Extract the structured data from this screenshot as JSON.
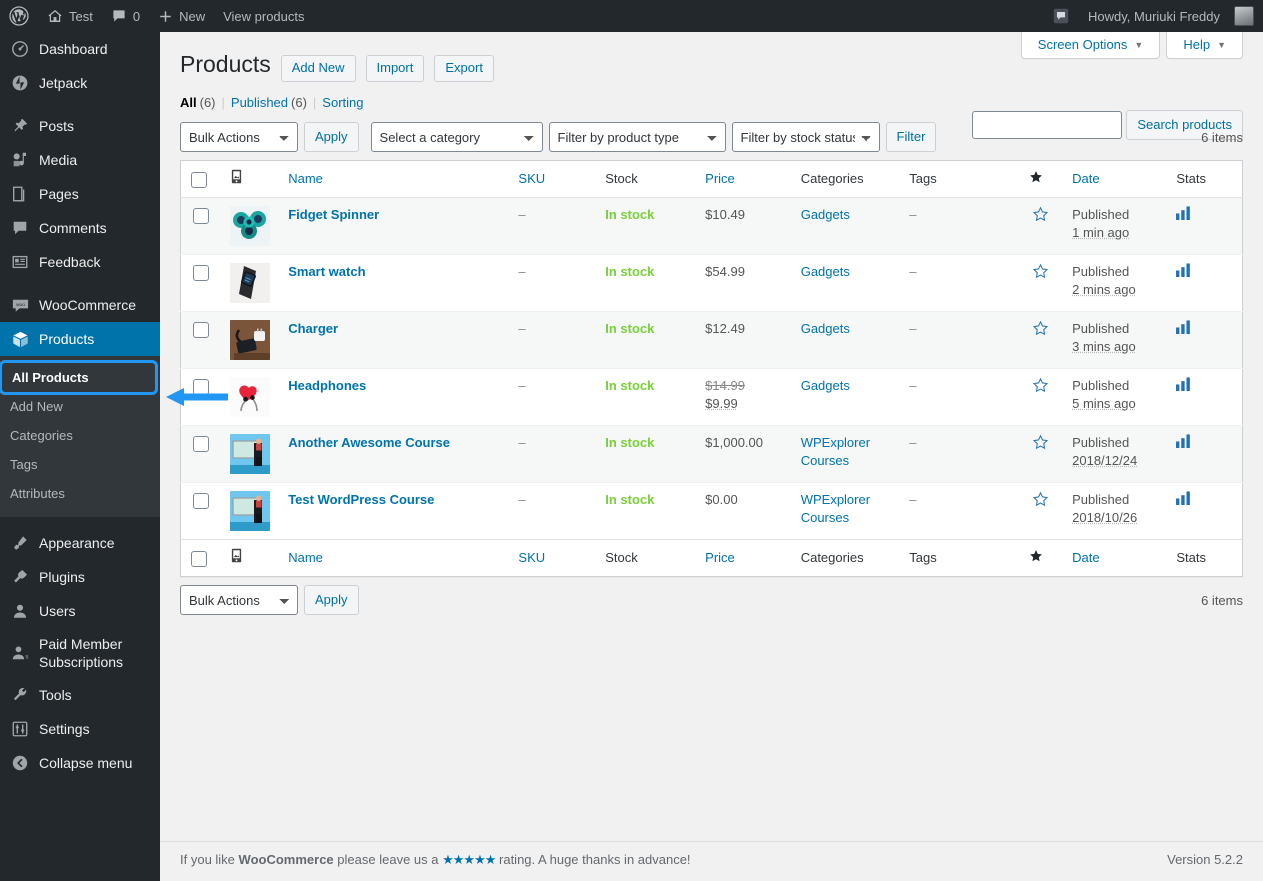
{
  "adminbar": {
    "logo_icon": "wordpress-logo-icon",
    "site_name": "Test",
    "site_icon": "home-icon",
    "comments_icon": "comment-bubble-icon",
    "comments_count": "0",
    "new_icon": "plus-icon",
    "new_label": "New",
    "view_products_label": "View products",
    "notifications_icon": "comment-bubble-icon",
    "howdy": "Howdy, Muriuki Freddy",
    "avatar_icon": "user-avatar"
  },
  "sidebar": {
    "items": [
      {
        "label": "Dashboard",
        "icon": "dashboard-icon",
        "key": "dashboard"
      },
      {
        "label": "Jetpack",
        "icon": "jetpack-icon",
        "key": "jetpack"
      },
      {
        "label": "Posts",
        "icon": "pin-icon",
        "key": "posts"
      },
      {
        "label": "Media",
        "icon": "media-icon",
        "key": "media"
      },
      {
        "label": "Pages",
        "icon": "pages-icon",
        "key": "pages"
      },
      {
        "label": "Comments",
        "icon": "comment-bubble-icon",
        "key": "comments"
      },
      {
        "label": "Feedback",
        "icon": "feedback-icon",
        "key": "feedback"
      },
      {
        "label": "WooCommerce",
        "icon": "woocommerce-icon",
        "key": "woocommerce"
      },
      {
        "label": "Products",
        "icon": "products-box-icon",
        "key": "products",
        "current": true
      },
      {
        "label": "Appearance",
        "icon": "paintbrush-icon",
        "key": "appearance"
      },
      {
        "label": "Plugins",
        "icon": "plug-icon",
        "key": "plugins"
      },
      {
        "label": "Users",
        "icon": "user-icon",
        "key": "users"
      },
      {
        "label": "Paid Member Subscriptions",
        "icon": "members-icon",
        "key": "paid-member-subscriptions"
      },
      {
        "label": "Tools",
        "icon": "wrench-icon",
        "key": "tools"
      },
      {
        "label": "Settings",
        "icon": "sliders-icon",
        "key": "settings"
      },
      {
        "label": "Collapse menu",
        "icon": "collapse-arrow-icon",
        "key": "collapse-menu"
      }
    ],
    "submenu": [
      {
        "label": "All Products",
        "current": true,
        "highlighted": true
      },
      {
        "label": "Add New"
      },
      {
        "label": "Categories"
      },
      {
        "label": "Tags"
      },
      {
        "label": "Attributes"
      }
    ],
    "annotation": {
      "arrow_icon": "left-arrow-annotation",
      "arrow_color": "#2196f3",
      "highlight_color": "#2196f3"
    }
  },
  "screen_meta": {
    "screen_options_label": "Screen Options",
    "help_label": "Help",
    "caret_icon": "chevron-down-icon"
  },
  "header": {
    "title": "Products",
    "actions": [
      {
        "label": "Add New",
        "key": "add-new"
      },
      {
        "label": "Import",
        "key": "import"
      },
      {
        "label": "Export",
        "key": "export"
      }
    ]
  },
  "views": {
    "all_label": "All",
    "all_count": "(6)",
    "published_label": "Published",
    "published_count": "(6)",
    "sorting_label": "Sorting",
    "divider": "|"
  },
  "search": {
    "value": "",
    "placeholder": "",
    "button_label": "Search products"
  },
  "tablenav_top": {
    "bulk_actions": "Bulk Actions",
    "apply_label": "Apply",
    "category_filter": "Select a category",
    "product_type_filter": "Filter by product type",
    "stock_status_filter": "Filter by stock status",
    "filter_label": "Filter",
    "items_count": "6 items"
  },
  "tablenav_bottom": {
    "bulk_actions": "Bulk Actions",
    "apply_label": "Apply",
    "items_count": "6 items"
  },
  "table": {
    "columns": {
      "checkbox": "select-all-checkbox",
      "thumbnail_icon": "image-icon",
      "name": "Name",
      "sku": "SKU",
      "stock": "Stock",
      "price": "Price",
      "categories": "Categories",
      "tags": "Tags",
      "featured_icon": "star-filled-icon",
      "date": "Date",
      "stats": "Stats"
    },
    "rows": [
      {
        "name": "Fidget Spinner",
        "thumb": "fidget-spinner-photo",
        "sku": "–",
        "stock": "In stock",
        "price": "$10.49",
        "sale_price": null,
        "categories": "Gadgets",
        "tags": "–",
        "featured": false,
        "date_status": "Published",
        "date_value": "1 min ago",
        "stats_icon": "bar-chart-icon"
      },
      {
        "name": "Smart watch",
        "thumb": "smart-watch-photo",
        "sku": "–",
        "stock": "In stock",
        "price": "$54.99",
        "sale_price": null,
        "categories": "Gadgets",
        "tags": "–",
        "featured": false,
        "date_status": "Published",
        "date_value": "2 mins ago",
        "stats_icon": "bar-chart-icon"
      },
      {
        "name": "Charger",
        "thumb": "charger-photo",
        "sku": "–",
        "stock": "In stock",
        "price": "$12.49",
        "sale_price": null,
        "categories": "Gadgets",
        "tags": "–",
        "featured": false,
        "date_status": "Published",
        "date_value": "3 mins ago",
        "stats_icon": "bar-chart-icon"
      },
      {
        "name": "Headphones",
        "thumb": "headphones-heart-photo",
        "sku": "–",
        "stock": "In stock",
        "price": "$14.99",
        "sale_price": "$9.99",
        "categories": "Gadgets",
        "tags": "–",
        "featured": false,
        "date_status": "Published",
        "date_value": "5 mins ago",
        "stats_icon": "bar-chart-icon"
      },
      {
        "name": "Another Awesome Course",
        "thumb": "course-presenter-photo",
        "sku": "–",
        "stock": "In stock",
        "price": "$1,000.00",
        "sale_price": null,
        "categories": "WPExplorer Courses",
        "tags": "–",
        "featured": false,
        "date_status": "Published",
        "date_value": "2018/12/24",
        "stats_icon": "bar-chart-icon"
      },
      {
        "name": "Test WordPress Course",
        "thumb": "course-presenter-photo",
        "sku": "–",
        "stock": "In stock",
        "price": "$0.00",
        "sale_price": null,
        "categories": "WPExplorer Courses",
        "tags": "–",
        "featured": false,
        "date_status": "Published",
        "date_value": "2018/10/26",
        "stats_icon": "bar-chart-icon"
      }
    ]
  },
  "footer": {
    "text_before": "If you like",
    "brand": "WooCommerce",
    "text_middle": "please leave us a",
    "stars": "★★★★★",
    "text_after": "rating. A huge thanks in advance!",
    "version": "Version 5.2.2"
  },
  "colors": {
    "admin_dark": "#23282d",
    "admin_submenu": "#32373c",
    "accent_blue": "#0073aa",
    "link_blue": "#0073aa",
    "in_stock_green": "#7ad03a",
    "annotation_blue": "#2196f3"
  }
}
